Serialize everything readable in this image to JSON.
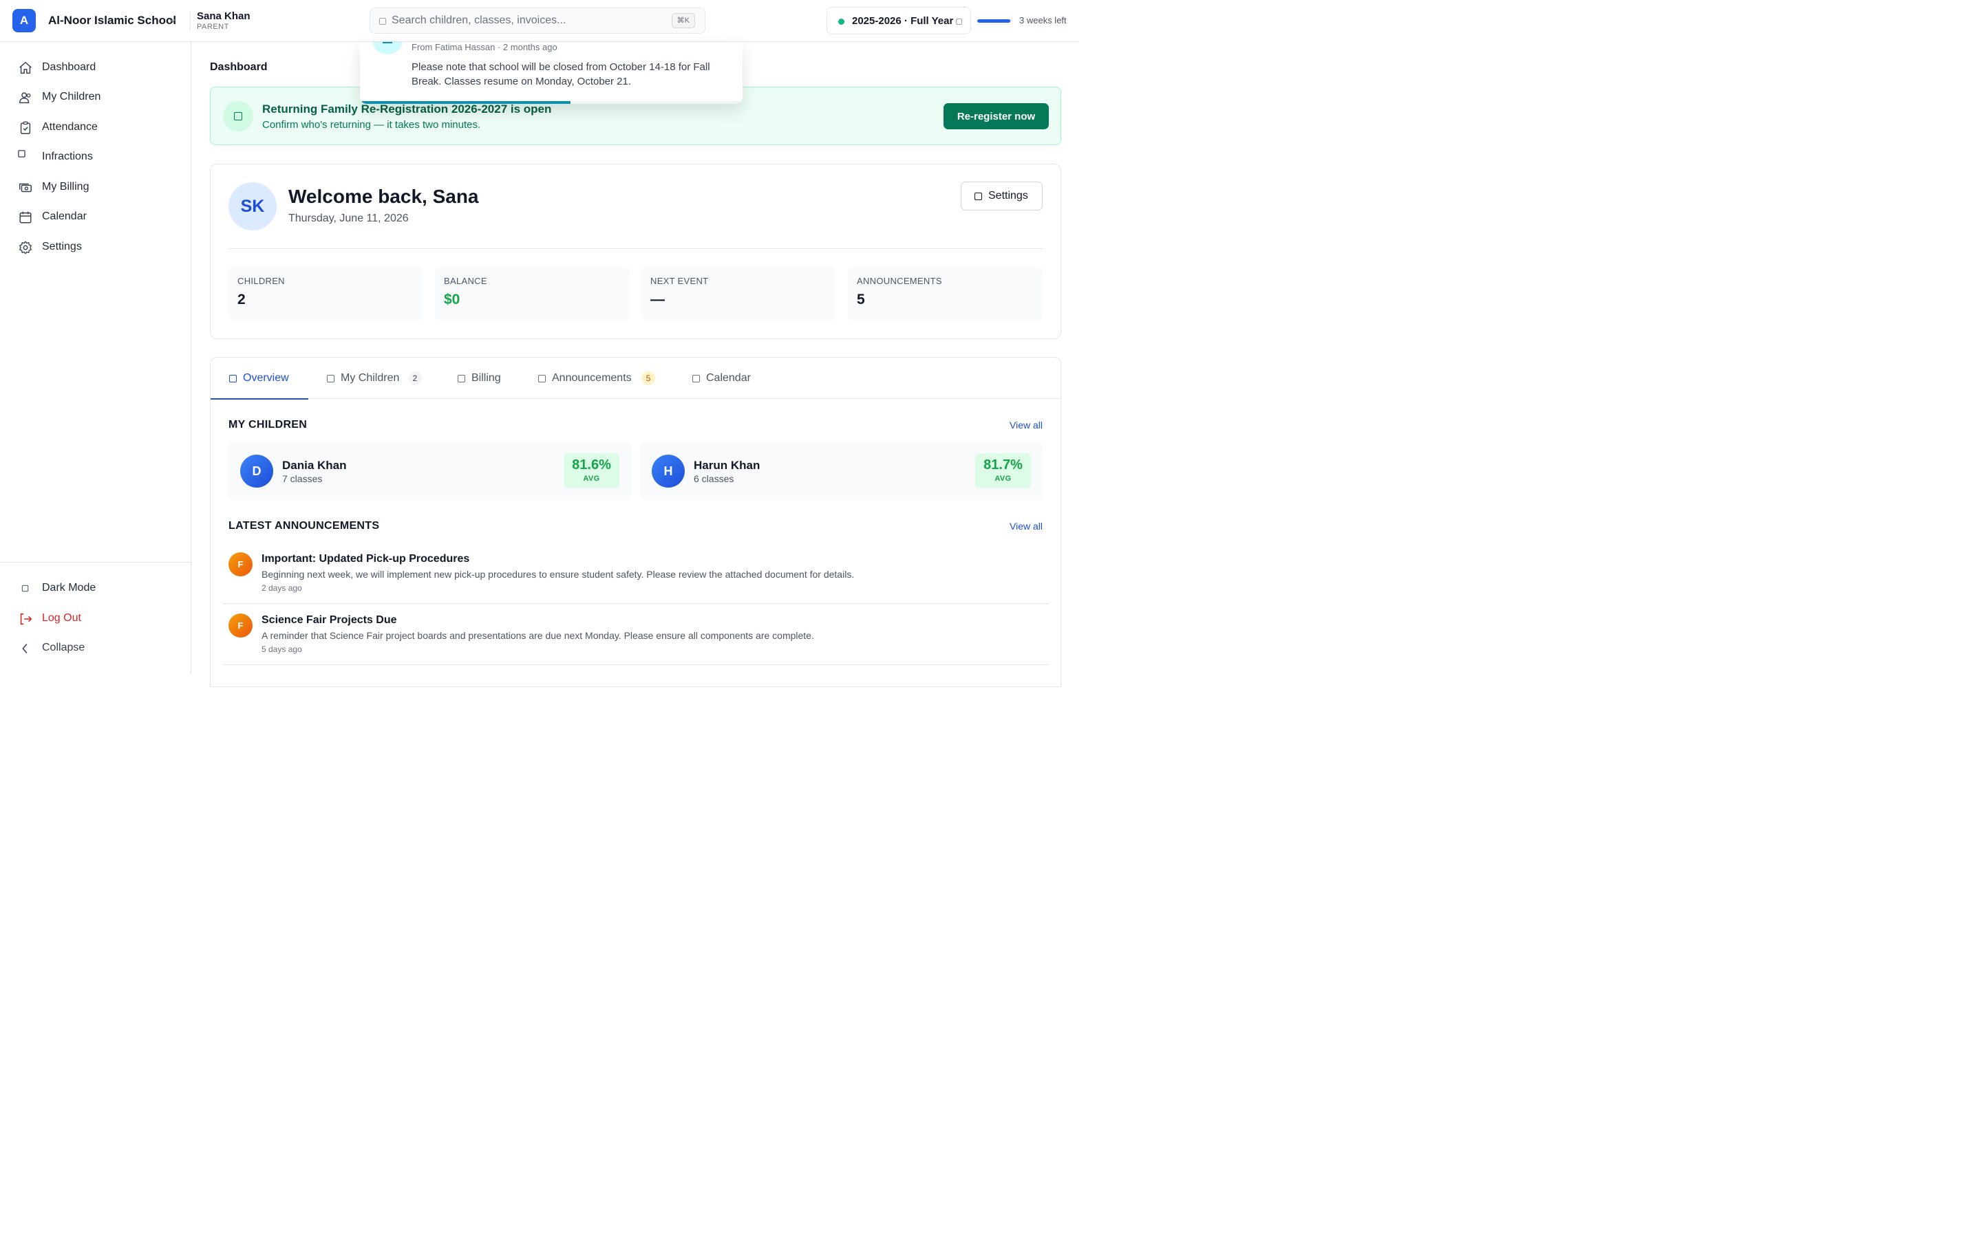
{
  "topbar": {
    "logo_letter": "A",
    "school_name": "Al-Noor Islamic School",
    "user_name": "Sana Khan",
    "user_role": "PARENT",
    "search_placeholder": "Search children, classes, invoices...",
    "search_shortcut": "⌘K",
    "year_label": "2025-2026 · Full Year",
    "year_status_color": "#10b981",
    "term_progress_fraction": 0.95,
    "weeks_left": "3 weeks left"
  },
  "sidebar": {
    "items": [
      {
        "label": "Dashboard",
        "icon": "home-icon"
      },
      {
        "label": "My Children",
        "icon": "users-icon"
      },
      {
        "label": "Attendance",
        "icon": "clipboard-check-icon"
      },
      {
        "label": "Infractions",
        "icon": "square-icon"
      },
      {
        "label": "My Billing",
        "icon": "cash-icon"
      },
      {
        "label": "Calendar",
        "icon": "calendar-icon"
      },
      {
        "label": "Settings",
        "icon": "gear-icon"
      }
    ],
    "bottom": {
      "dark_mode": "Dark Mode",
      "log_out": "Log Out",
      "collapse": "Collapse"
    }
  },
  "main": {
    "breadcrumb": "Dashboard",
    "banner": {
      "title": "Returning Family Re-Registration 2026-2027 is open",
      "subtitle": "Confirm who's returning — it takes two minutes.",
      "button": "Re-register now"
    },
    "toast": {
      "meta": "From Fatima Hassan · 2 months ago",
      "body": "Please note that school will be closed from October 14-18 for Fall Break. Classes resume on Monday, October 21.",
      "progress_fraction": 0.55
    },
    "welcome": {
      "initials": "SK",
      "title": "Welcome back, Sana",
      "date": "Thursday, June 11, 2026",
      "settings_button": "Settings"
    },
    "stats": [
      {
        "label": "CHILDREN",
        "value": "2",
        "color": "#111827"
      },
      {
        "label": "BALANCE",
        "value": "$0",
        "color": "#16a34a"
      },
      {
        "label": "NEXT EVENT",
        "value": "—",
        "color": "#111827"
      },
      {
        "label": "ANNOUNCEMENTS",
        "value": "5",
        "color": "#111827"
      }
    ],
    "tabs": [
      {
        "label": "Overview",
        "badge": ""
      },
      {
        "label": "My Children",
        "badge": "2"
      },
      {
        "label": "Billing",
        "badge": ""
      },
      {
        "label": "Announcements",
        "badge": "5"
      },
      {
        "label": "Calendar",
        "badge": ""
      }
    ],
    "active_tab": "Overview",
    "children_section": {
      "title": "MY CHILDREN",
      "view_all": "View all",
      "children": [
        {
          "initial": "D",
          "name": "Dania Khan",
          "classes": "7 classes",
          "avg": "81.6%",
          "avg_label": "AVG"
        },
        {
          "initial": "H",
          "name": "Harun Khan",
          "classes": "6 classes",
          "avg": "81.7%",
          "avg_label": "AVG"
        }
      ]
    },
    "announcements_section": {
      "title": "LATEST ANNOUNCEMENTS",
      "view_all": "View all",
      "items": [
        {
          "initial": "F",
          "title": "Important: Updated Pick-up Procedures",
          "body": "Beginning next week, we will implement new pick-up procedures to ensure student safety. Please review the attached document for details.",
          "time": "2 days ago"
        },
        {
          "initial": "F",
          "title": "Science Fair Projects Due",
          "body": "A reminder that Science Fair project boards and presentations are due next Monday. Please ensure all components are complete.",
          "time": "5 days ago"
        }
      ]
    }
  }
}
